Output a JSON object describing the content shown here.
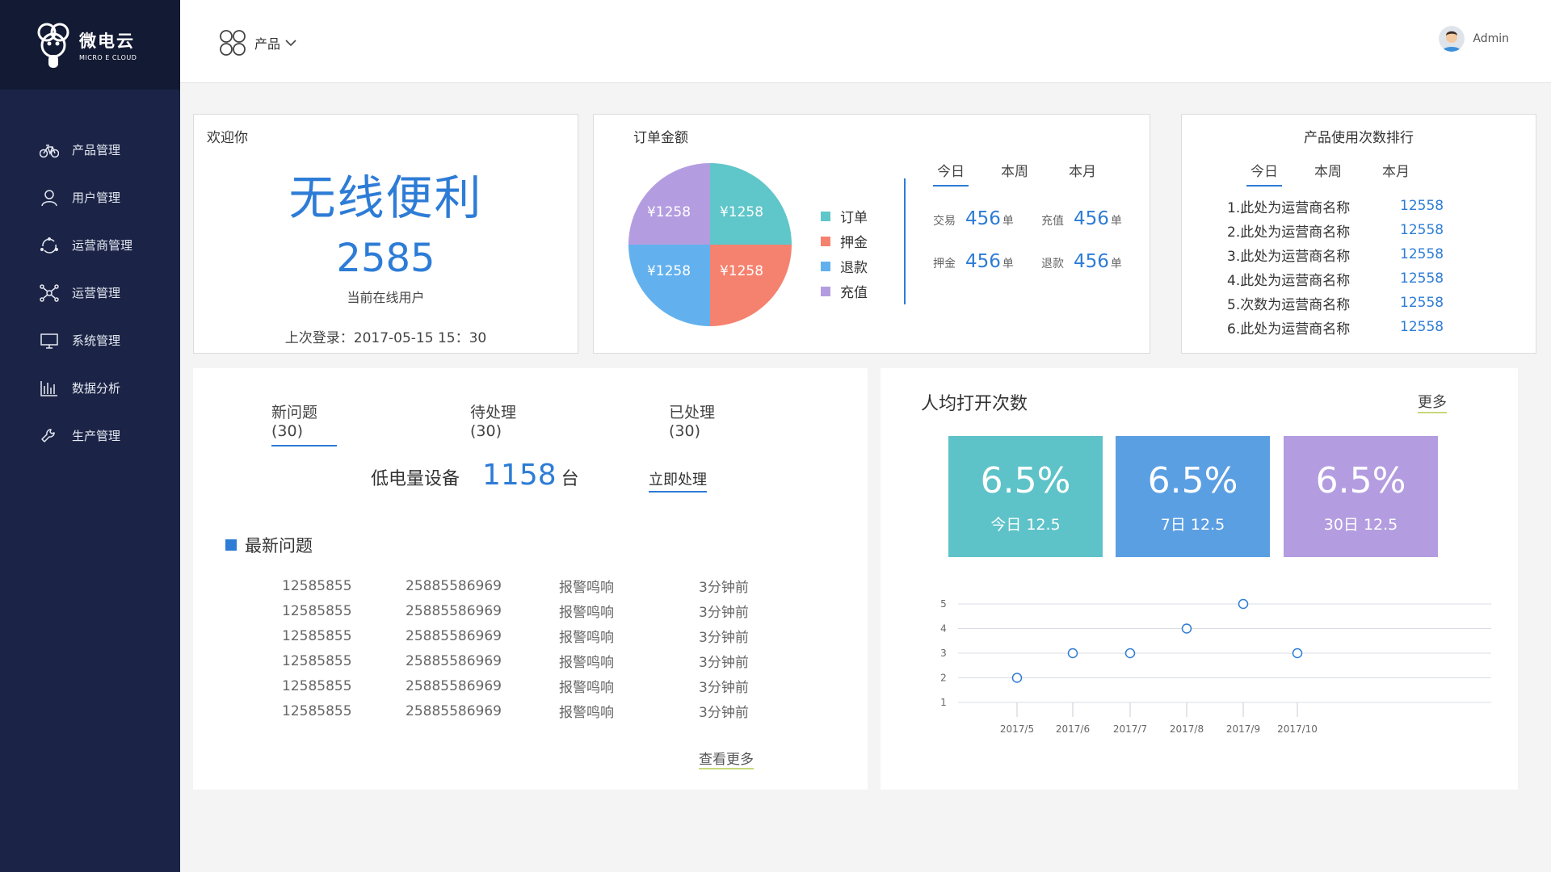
{
  "brand": {
    "name_cn": "微电云",
    "name_en": "MICRO E CLOUD"
  },
  "sidebar": {
    "items": [
      {
        "label": "产品管理",
        "icon": "bicycle-icon"
      },
      {
        "label": "用户管理",
        "icon": "user-icon"
      },
      {
        "label": "运营商管理",
        "icon": "refresh-icon"
      },
      {
        "label": "运营管理",
        "icon": "network-icon"
      },
      {
        "label": "系统管理",
        "icon": "monitor-icon"
      },
      {
        "label": "数据分析",
        "icon": "bar-chart-icon"
      },
      {
        "label": "生产管理",
        "icon": "wrench-icon"
      }
    ]
  },
  "header": {
    "product_label": "产品",
    "user_name": "Admin"
  },
  "welcome": {
    "title": "欢迎你",
    "headline": "无线便利",
    "online_count": "2585",
    "online_label": "当前在线用户",
    "last_login": "上次登录：2017-05-15  15：30"
  },
  "orders": {
    "title": "订单金额",
    "pie_labels": [
      "¥1258",
      "¥1258",
      "¥1258",
      "¥1258"
    ],
    "legend": [
      {
        "label": "订单",
        "color": "#5fc6c9"
      },
      {
        "label": "押金",
        "color": "#f5826f"
      },
      {
        "label": "退款",
        "color": "#62b1ee"
      },
      {
        "label": "充值",
        "color": "#b39de0"
      }
    ],
    "tabs": [
      "今日",
      "本周",
      "本月"
    ],
    "stats": [
      {
        "label": "交易",
        "value": "456",
        "unit": "单"
      },
      {
        "label": "充值",
        "value": "456",
        "unit": "单"
      },
      {
        "label": "押金",
        "value": "456",
        "unit": "单"
      },
      {
        "label": "退款",
        "value": "456",
        "unit": "单"
      }
    ]
  },
  "ranking": {
    "title": "产品使用次数排行",
    "tabs": [
      "今日",
      "本周",
      "本月"
    ],
    "rows": [
      {
        "name": "1.此处为运营商名称",
        "value": "12558"
      },
      {
        "name": "2.此处为运营商名称",
        "value": "12558"
      },
      {
        "name": "3.此处为运营商名称",
        "value": "12558"
      },
      {
        "name": "4.此处为运营商名称",
        "value": "12558"
      },
      {
        "name": "5.次数为运营商名称",
        "value": "12558"
      },
      {
        "name": "6.此处为运营商名称",
        "value": "12558"
      }
    ]
  },
  "issues": {
    "tabs": [
      "新问题(30)",
      "待处理(30)",
      "已处理(30)"
    ],
    "low_battery_label": "低电量设备",
    "low_battery_count": "1158",
    "low_battery_unit": "台",
    "handle_label": "立即处理",
    "latest_title": "最新问题",
    "rows": [
      [
        "12585855",
        "25885586969",
        "报警鸣响",
        "3分钟前"
      ],
      [
        "12585855",
        "25885586969",
        "报警鸣响",
        "3分钟前"
      ],
      [
        "12585855",
        "25885586969",
        "报警鸣响",
        "3分钟前"
      ],
      [
        "12585855",
        "25885586969",
        "报警鸣响",
        "3分钟前"
      ],
      [
        "12585855",
        "25885586969",
        "报警鸣响",
        "3分钟前"
      ],
      [
        "12585855",
        "25885586969",
        "报警鸣响",
        "3分钟前"
      ]
    ],
    "see_more": "查看更多"
  },
  "opens": {
    "title": "人均打开次数",
    "more": "更多",
    "tiles": [
      {
        "pct": "6.5%",
        "sub": "今日 12.5",
        "color": "#5ec3c8"
      },
      {
        "pct": "6.5%",
        "sub": "7日 12.5",
        "color": "#5b9fe3"
      },
      {
        "pct": "6.5%",
        "sub": "30日 12.5",
        "color": "#b39de0"
      }
    ]
  },
  "chart_data": {
    "type": "line",
    "categories": [
      "2017/5",
      "2017/6",
      "2017/7",
      "2017/8",
      "2017/9",
      "2017/10"
    ],
    "points": [
      {
        "x": "2017/5",
        "y": 2
      },
      {
        "x": "2017/6",
        "y": 3
      },
      {
        "x": "2017/7",
        "y": 3
      },
      {
        "x": "2017/8",
        "y": 4
      },
      {
        "x": "2017/9",
        "y": 5
      },
      {
        "x": "2017/10",
        "y": 3
      }
    ],
    "yticks": [
      1,
      2,
      3,
      4,
      5
    ],
    "ylim": [
      1,
      5
    ],
    "grid": true,
    "point_color": "#2d7cd6"
  }
}
